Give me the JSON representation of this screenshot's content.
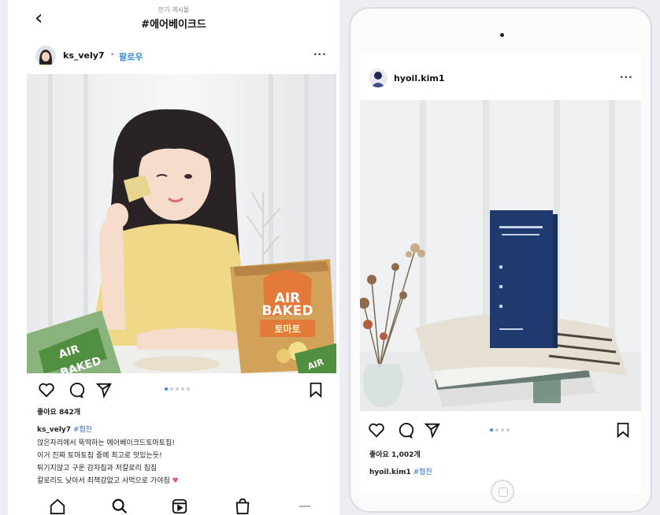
{
  "left_post": {
    "header": {
      "subtitle": "인기 게시물",
      "hashtag": "#에어베이크드"
    },
    "user": {
      "username": "ks_vely7",
      "separator": "•",
      "follow": "팔로우"
    },
    "more": "···",
    "product": {
      "line1": "AIR",
      "line2": "BAKED",
      "flavor": "토마토"
    },
    "likes": "좋아요 842개",
    "caption": {
      "username": "ks_vely7",
      "tag": "#협찬",
      "lines": [
        "앉은자리에서 뚝딱하는 에어베이크드토마토칩!",
        "이거 진짜 토마토칩 중에 최고로 맛있는듯!",
        "튀기지않고 구운 감자칩과 저칼로리 칩칩",
        "칼로리도 낮아서 죄책감없고 사먹으로 가야짐"
      ]
    },
    "carousel": {
      "count": 5,
      "active": 0
    }
  },
  "right_post": {
    "user": {
      "username": "hyoil.kim1"
    },
    "more": "···",
    "likes": "좋아요 1,002개",
    "caption": {
      "username": "hyoil.kim1",
      "tag": "#협찬"
    },
    "carousel": {
      "count": 4,
      "active": 0
    }
  },
  "colors": {
    "accent": "#3a8fe0",
    "hashtag": "#2f6fbf"
  }
}
